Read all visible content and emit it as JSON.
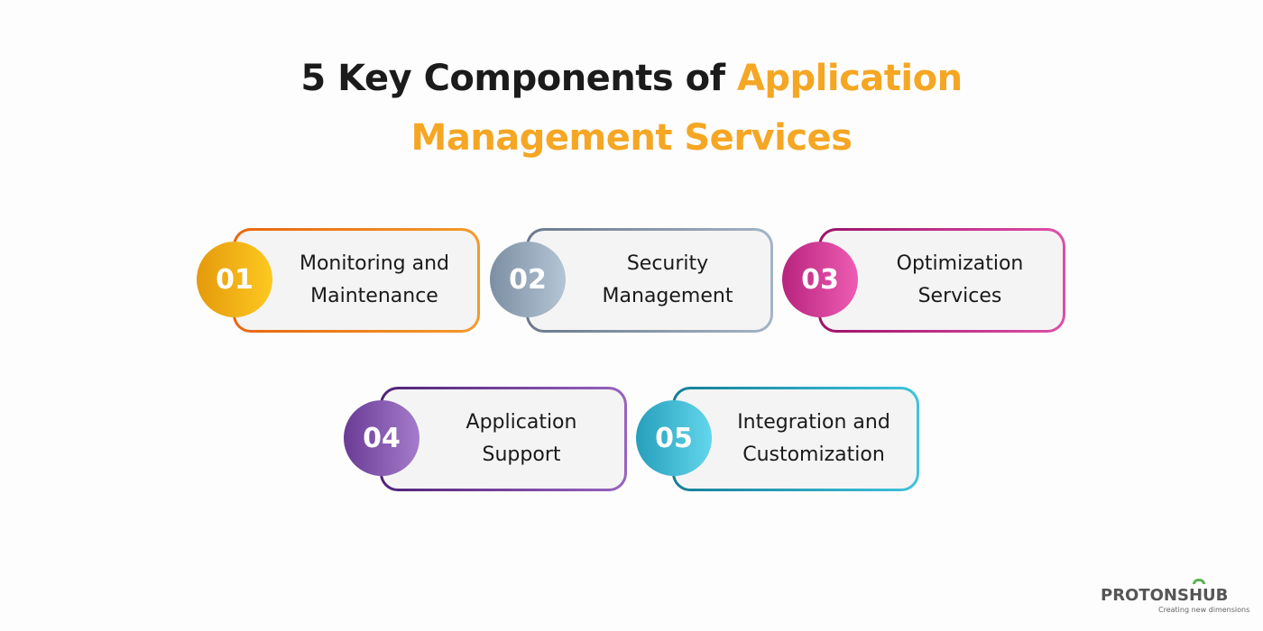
{
  "header": {
    "title_part1": "5 Key Components of ",
    "title_highlight": "Application",
    "title_line2": "Management Services"
  },
  "components": [
    {
      "number": "01",
      "line1": "Monitoring and",
      "line2": "Maintenance",
      "color": "#f08a1e"
    },
    {
      "number": "02",
      "line1": "Security",
      "line2": "Management",
      "color": "#8a9bad"
    },
    {
      "number": "03",
      "line1": "Optimization",
      "line2": "Services",
      "color": "#c62f8f"
    },
    {
      "number": "04",
      "line1": "Application",
      "line2": "Support",
      "color": "#7a4aa6"
    },
    {
      "number": "05",
      "line1": "Integration and",
      "line2": "Customization",
      "color": "#2aa6c2"
    }
  ],
  "colors": {
    "accent": "#f5a623",
    "title": "#1b1b1b",
    "card_bg": "#f4f4f4"
  },
  "logo": {
    "name": "PROTONSHUB",
    "tagline": "Creating new dimensions"
  }
}
